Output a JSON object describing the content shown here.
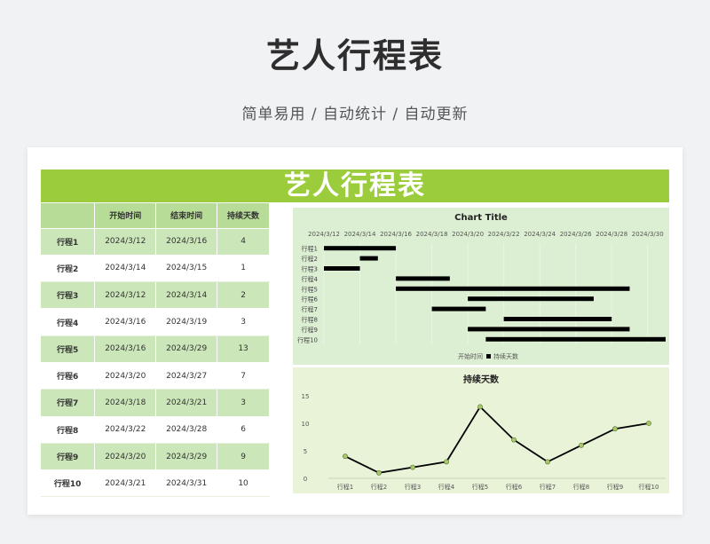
{
  "header": {
    "title": "艺人行程表",
    "subtitle": "简单易用  /  自动统计  /  自动更新"
  },
  "sheet": {
    "banner": "艺人行程表",
    "columns": [
      "",
      "开始时间",
      "结束时间",
      "持续天数"
    ],
    "rows": [
      {
        "name": "行程1",
        "start": "2024/3/12",
        "end": "2024/3/16",
        "days": "4"
      },
      {
        "name": "行程2",
        "start": "2024/3/14",
        "end": "2024/3/15",
        "days": "1"
      },
      {
        "name": "行程3",
        "start": "2024/3/12",
        "end": "2024/3/14",
        "days": "2"
      },
      {
        "name": "行程4",
        "start": "2024/3/16",
        "end": "2024/3/19",
        "days": "3"
      },
      {
        "name": "行程5",
        "start": "2024/3/16",
        "end": "2024/3/29",
        "days": "13"
      },
      {
        "name": "行程6",
        "start": "2024/3/20",
        "end": "2024/3/27",
        "days": "7"
      },
      {
        "name": "行程7",
        "start": "2024/3/18",
        "end": "2024/3/21",
        "days": "3"
      },
      {
        "name": "行程8",
        "start": "2024/3/22",
        "end": "2024/3/28",
        "days": "6"
      },
      {
        "name": "行程9",
        "start": "2024/3/20",
        "end": "2024/3/29",
        "days": "9"
      },
      {
        "name": "行程10",
        "start": "2024/3/21",
        "end": "2024/3/31",
        "days": "10"
      }
    ]
  },
  "colors": {
    "banner": "#9bcc3c",
    "header_row": "#b7dc98",
    "alt_row": "#cbe6b8",
    "gantt_bar": "#000000",
    "line": "#000000",
    "marker": "#a8c96a"
  },
  "chart_data": [
    {
      "type": "bar",
      "subtype": "gantt",
      "title": "Chart Title",
      "categories": [
        "行程1",
        "行程2",
        "行程3",
        "行程4",
        "行程5",
        "行程6",
        "行程7",
        "行程8",
        "行程9",
        "行程10"
      ],
      "series": [
        {
          "name": "开始时间",
          "values": [
            "2024/3/12",
            "2024/3/14",
            "2024/3/12",
            "2024/3/16",
            "2024/3/16",
            "2024/3/20",
            "2024/3/18",
            "2024/3/22",
            "2024/3/20",
            "2024/3/21"
          ],
          "visible": false
        },
        {
          "name": "持续天数",
          "values": [
            4,
            1,
            2,
            3,
            13,
            7,
            3,
            6,
            9,
            10
          ]
        }
      ],
      "x_ticks": [
        "2024/3/12",
        "2024/3/14",
        "2024/3/16",
        "2024/3/18",
        "2024/3/20",
        "2024/3/22",
        "2024/3/24",
        "2024/3/26",
        "2024/3/28",
        "2024/3/30"
      ],
      "xlim": [
        "2024/3/12",
        "2024/3/31"
      ],
      "legend": [
        "开始时间",
        "持续天数"
      ],
      "legend_position": "bottom",
      "grid": true,
      "y_reversed": true
    },
    {
      "type": "line",
      "title": "持续天数",
      "categories": [
        "行程1",
        "行程2",
        "行程3",
        "行程4",
        "行程5",
        "行程6",
        "行程7",
        "行程8",
        "行程9",
        "行程10"
      ],
      "values": [
        4,
        1,
        2,
        3,
        13,
        7,
        3,
        6,
        9,
        10
      ],
      "y_ticks": [
        "0",
        "5",
        "10",
        "15"
      ],
      "ylim": [
        0,
        15
      ],
      "grid": false,
      "markers": true
    }
  ]
}
